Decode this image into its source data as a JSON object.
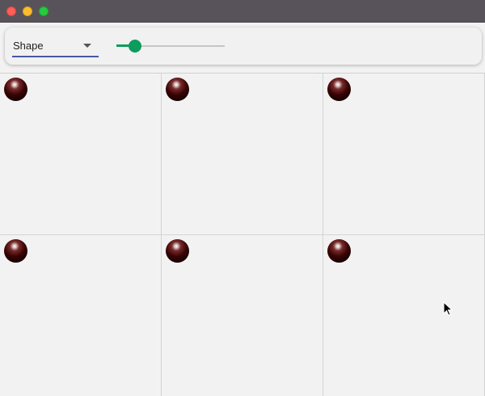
{
  "window": {
    "controls": [
      "close",
      "minimize",
      "maximize"
    ]
  },
  "toolbar": {
    "shape_select": {
      "value": "Shape"
    },
    "size_slider": {
      "value_fraction": 0.17
    }
  },
  "grid": {
    "columns": 3,
    "rows": 2,
    "cells": [
      {
        "shape": "sphere"
      },
      {
        "shape": "sphere"
      },
      {
        "shape": "sphere"
      },
      {
        "shape": "sphere"
      },
      {
        "shape": "sphere"
      },
      {
        "shape": "sphere"
      }
    ]
  },
  "colors": {
    "titlebar": "#58535a",
    "accent_select": "#4a56a6",
    "accent_slider": "#0c9c5c",
    "sphere": "#3a0505"
  }
}
